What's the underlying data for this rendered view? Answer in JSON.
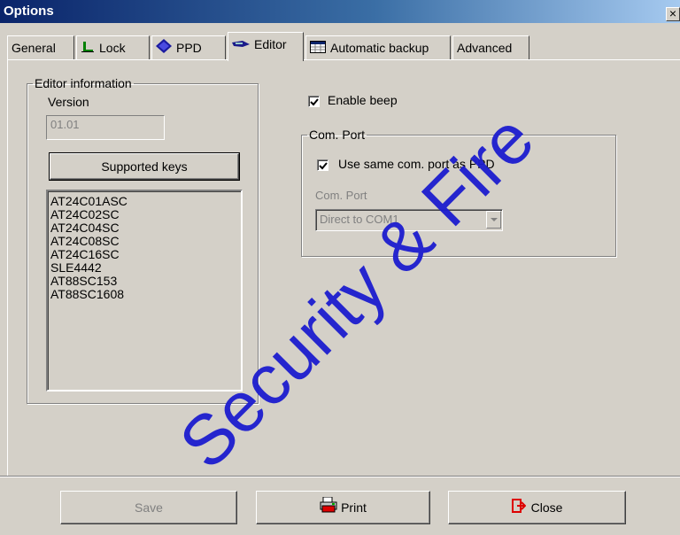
{
  "window": {
    "title": "Options",
    "close_glyph": "×"
  },
  "tabs": [
    {
      "label": "General",
      "icon": null
    },
    {
      "label": "Lock",
      "icon": "lock-icon"
    },
    {
      "label": "PPD",
      "icon": "ppd-icon"
    },
    {
      "label": "Editor",
      "icon": "editor-icon",
      "active": true
    },
    {
      "label": "Automatic backup",
      "icon": "calendar-icon"
    },
    {
      "label": "Advanced",
      "icon": null
    }
  ],
  "editor_info": {
    "legend": "Editor information",
    "version_label": "Version",
    "version_value": "01.01",
    "supported_keys_button": "Supported keys",
    "keys": [
      "AT24C01ASC",
      "AT24C02SC",
      "AT24C04SC",
      "AT24C08SC",
      "AT24C16SC",
      "SLE4442",
      "AT88SC153",
      "AT88SC1608"
    ]
  },
  "enable_beep": {
    "label": "Enable beep",
    "checked": true
  },
  "com_port": {
    "legend": "Com. Port",
    "use_same_label": "Use same com. port as PPD",
    "use_same_checked": true,
    "port_label": "Com. Port",
    "port_value": "Direct to COM1"
  },
  "buttons": {
    "save": "Save",
    "print": "Print",
    "close": "Close"
  },
  "watermark": "Security & Fire",
  "colors": {
    "watermark": "#1c1ccf",
    "title_bar": "#0a246a",
    "face": "#d4d0c8"
  }
}
